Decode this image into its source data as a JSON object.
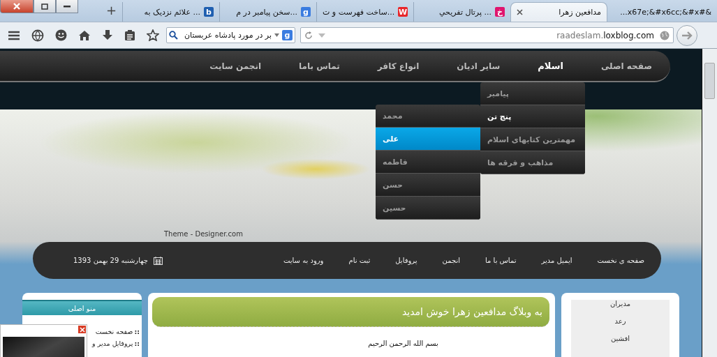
{
  "window_controls": [
    {
      "kind": "close"
    },
    {
      "kind": "restore"
    },
    {
      "kind": "minimize"
    }
  ],
  "tabs": [
    {
      "label": "...x67e;&#x6cc;&#x#&",
      "selected": false
    },
    {
      "label": "مدافعين زهرا",
      "selected": true
    },
    {
      "label": "پرتال تفريحي ...",
      "selected": false,
      "favicon": {
        "glyph": "خ",
        "color": "#e0156e"
      }
    },
    {
      "label": "ساخت فهرست و ت...",
      "selected": false,
      "favicon": {
        "glyph": "W",
        "color": "#e8262a"
      }
    },
    {
      "label": "سخن پيامبر در م...",
      "selected": false,
      "favicon": {
        "glyph": "g",
        "color": "#3a7ce0"
      }
    },
    {
      "label": "علائم نزديک به ...",
      "selected": false,
      "favicon": {
        "glyph": "b",
        "color": "#1f5fb0"
      }
    }
  ],
  "new_tab": "+",
  "toolbar": {
    "search": {
      "value": "بر در مورد پادشاه عربستان",
      "engine_glyph": "g"
    },
    "url": {
      "subdomain": "raadeslam.",
      "domain": "loxblog.com"
    }
  },
  "main_menu": [
    {
      "label": "صفحه اصلی",
      "selected": false
    },
    {
      "label": "اسلام",
      "selected": true
    },
    {
      "label": "ساير اديان",
      "selected": false
    },
    {
      "label": "انواع کافر",
      "selected": false
    },
    {
      "label": "تماس باما",
      "selected": false
    },
    {
      "label": "انجمن سايت",
      "selected": false
    }
  ],
  "dropdown": [
    {
      "label": "پيامبر",
      "selected": false
    },
    {
      "label": "پنج تن",
      "selected": true
    },
    {
      "label": "مهمترين کتابهای اسلام",
      "selected": false
    },
    {
      "label": "مذاهب و فرقه ها",
      "selected": false
    }
  ],
  "submenu": [
    {
      "label": "محمد",
      "selected": false
    },
    {
      "label": "علی",
      "selected": true
    },
    {
      "label": "فاطمه",
      "selected": false
    },
    {
      "label": "حسن",
      "selected": false
    },
    {
      "label": "حسين",
      "selected": false
    }
  ],
  "banner": {
    "credit": "Theme - Designer.com"
  },
  "nav": [
    {
      "label": "صفحه ی نخست"
    },
    {
      "label": "ايميل مدير"
    },
    {
      "label": "تماس با ما"
    },
    {
      "label": "انجمن"
    },
    {
      "label": "پروفايل"
    },
    {
      "label": "ثبت نام"
    },
    {
      "label": "ورود به سايت"
    }
  ],
  "date": "چهارشنبه 29 بهمن 1393",
  "left_box": {
    "title": "منو اصلی",
    "items": [
      {
        "bullet": "::",
        "label": "صفحه نخست"
      },
      {
        "bullet": "::",
        "label": "پروفايل مدير و"
      }
    ]
  },
  "main_box": {
    "title": "به وبلاگ مدافعين زهرا خوش امديد",
    "text": "بسم الله الرحمن الرحيم"
  },
  "right_box": {
    "items": [
      "مديران",
      "رعد",
      "افشين"
    ]
  }
}
